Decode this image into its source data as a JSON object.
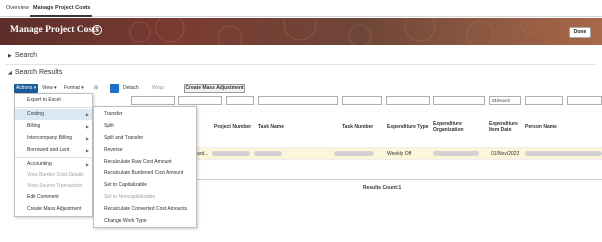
{
  "tabs": {
    "overview": "Overview",
    "active": "Manage Project Costs",
    "close_glyph": "×"
  },
  "header": {
    "title": "Manage Project Costs",
    "help_glyph": "?",
    "done_label": "Done"
  },
  "sections": {
    "search": "Search",
    "results": "Search Results",
    "caret_collapsed": "▶",
    "caret_expanded": "◢"
  },
  "toolbar": {
    "actions": "Actions ▾",
    "view": "View ▾",
    "format": "Format ▾",
    "freeze_glyph": "⊞",
    "detach": "Detach",
    "wrap": "Wrap",
    "mass_adjustment": "Create Mass Adjustment"
  },
  "filters": {
    "date_value": "01/Nov/2"
  },
  "columns": {
    "project_number": "Project Number",
    "task_name": "Task Name",
    "task_number": "Task Number",
    "expenditure_type": "Expenditure Type",
    "expenditure_org_1": "Expenditure",
    "expenditure_org_2": "Organization",
    "expenditure_date_1": "Expenditure",
    "expenditure_date_2": "Item Date",
    "person_name": "Person Name"
  },
  "row": {
    "truncated_text": "ard...",
    "expenditure_type": "Weekly Off",
    "date": "01/Nov/2022"
  },
  "results_count": "Results Count:1",
  "actions_menu": {
    "items": [
      {
        "label": "Export to Excel",
        "disabled": false,
        "submenu": false
      },
      {
        "label": "Costing",
        "disabled": false,
        "submenu": true
      },
      {
        "label": "Billing",
        "disabled": false,
        "submenu": true
      },
      {
        "label": "Intercompany Billing",
        "disabled": false,
        "submenu": true
      },
      {
        "label": "Borrowed and Lent",
        "disabled": false,
        "submenu": true
      },
      {
        "label": "Accounting",
        "disabled": false,
        "submenu": true
      },
      {
        "label": "View Burden Cost Details",
        "disabled": true,
        "submenu": false
      },
      {
        "label": "View Source Transaction",
        "disabled": true,
        "submenu": false
      },
      {
        "label": "Edit Comment",
        "disabled": false,
        "submenu": false
      },
      {
        "label": "Create Mass Adjustment",
        "disabled": false,
        "submenu": false
      }
    ]
  },
  "costing_submenu": {
    "items": [
      {
        "label": "Transfer",
        "disabled": false
      },
      {
        "label": "Split",
        "disabled": false
      },
      {
        "label": "Split and Transfer",
        "disabled": false
      },
      {
        "label": "Reverse",
        "disabled": false
      },
      {
        "label": "Recalculate Raw Cost Amount",
        "disabled": false
      },
      {
        "label": "Recalculate Burdened Cost Amount",
        "disabled": false
      },
      {
        "label": "Set to Capitalizable",
        "disabled": false
      },
      {
        "label": "Set to Noncapitalizable",
        "disabled": true
      },
      {
        "label": "Recalculate Converted Cost Amounts",
        "disabled": false
      },
      {
        "label": "Change Work Type",
        "disabled": false
      }
    ]
  },
  "colors": {
    "banner": "#6e3a32",
    "actions_blue": "#1a5c9b",
    "row_highlight": "#fbf6d9"
  }
}
